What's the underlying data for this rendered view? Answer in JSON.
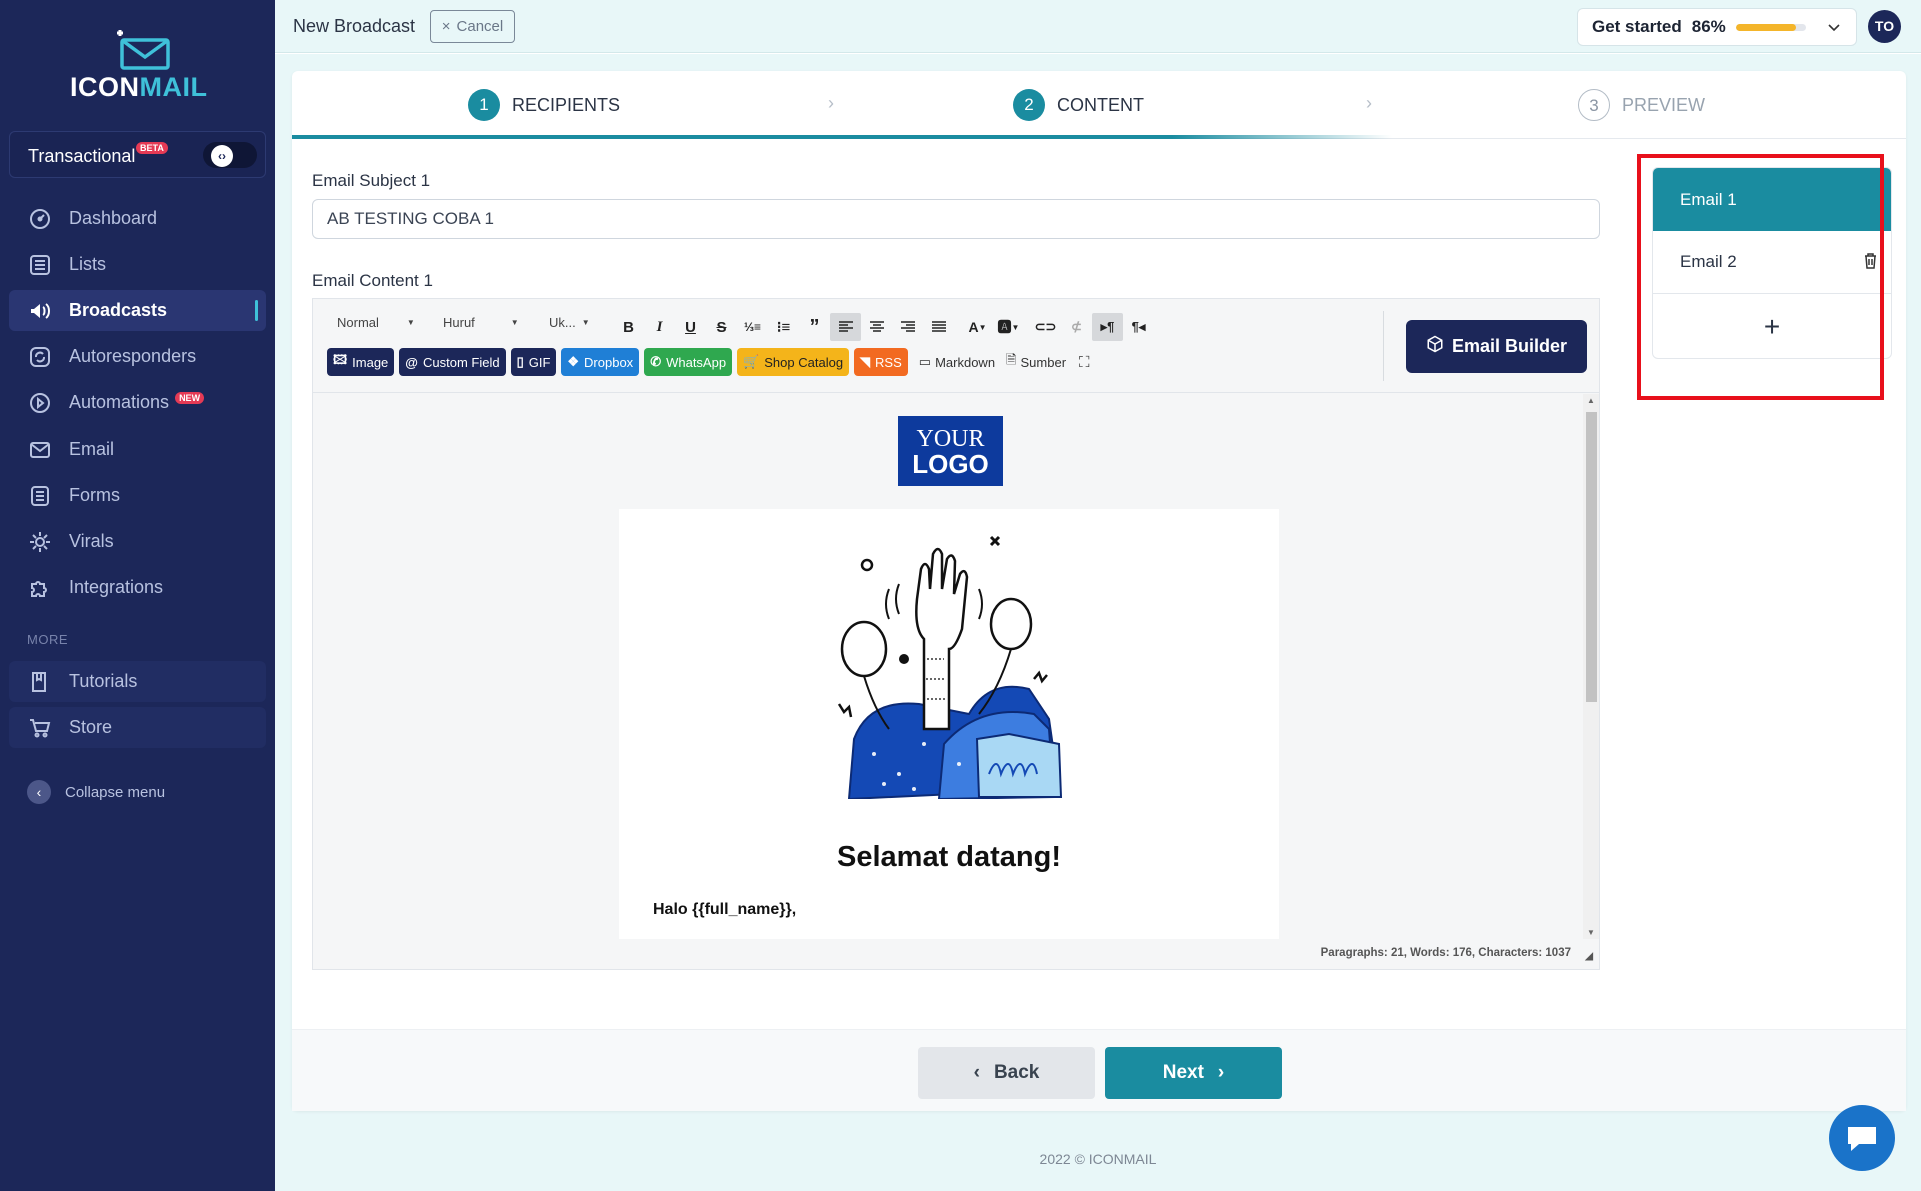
{
  "sidebar": {
    "logo": {
      "part1": "ICON",
      "part2": "MAIL"
    },
    "transactional": {
      "label": "Transactional",
      "badge": "BETA"
    },
    "items": [
      {
        "label": "Dashboard",
        "icon": "dashboard-icon"
      },
      {
        "label": "Lists",
        "icon": "list-icon"
      },
      {
        "label": "Broadcasts",
        "icon": "megaphone-icon",
        "active": true
      },
      {
        "label": "Autoresponders",
        "icon": "autoresponder-icon"
      },
      {
        "label": "Automations",
        "icon": "automation-icon",
        "badge": "NEW"
      },
      {
        "label": "Email",
        "icon": "envelope-icon"
      },
      {
        "label": "Forms",
        "icon": "form-icon"
      },
      {
        "label": "Virals",
        "icon": "viral-icon"
      },
      {
        "label": "Integrations",
        "icon": "puzzle-icon"
      }
    ],
    "more_label": "MORE",
    "more_items": [
      {
        "label": "Tutorials",
        "icon": "book-icon"
      },
      {
        "label": "Store",
        "icon": "cart-icon"
      }
    ],
    "collapse_label": "Collapse menu"
  },
  "topbar": {
    "title": "New Broadcast",
    "cancel_label": "Cancel",
    "get_started": {
      "label": "Get started",
      "percent_label": "86%",
      "progress": 0.86
    },
    "avatar": "TO"
  },
  "steps": [
    {
      "num": "1",
      "label": "RECIPIENTS"
    },
    {
      "num": "2",
      "label": "CONTENT"
    },
    {
      "num": "3",
      "label": "PREVIEW"
    }
  ],
  "form": {
    "subject_label": "Email Subject 1",
    "subject_value": "AB TESTING COBA 1",
    "content_label": "Email Content 1"
  },
  "editor": {
    "format_select": "Normal",
    "font_select": "Huruf",
    "size_select": "Uk...",
    "insert_buttons": [
      {
        "label": "Image",
        "color": "#1c2759",
        "icon": "image-icon"
      },
      {
        "label": "Custom Field",
        "color": "#1c2759",
        "icon": "at-icon"
      },
      {
        "label": "GIF",
        "color": "#1c2759",
        "icon": "gif-icon"
      },
      {
        "label": "Dropbox",
        "color": "#1f7fd6",
        "icon": "dropbox-icon"
      },
      {
        "label": "WhatsApp",
        "color": "#2fa84f",
        "icon": "whatsapp-icon"
      },
      {
        "label": "Shop Catalog",
        "color": "#f4b41a",
        "icon": "shop-cart-icon"
      },
      {
        "label": "RSS",
        "color": "#f26a21",
        "icon": "rss-icon"
      }
    ],
    "markdown_label": "Markdown",
    "source_label": "Sumber",
    "email_builder_label": "Email Builder",
    "logo_line1": "YOUR",
    "logo_line2": "LOGO",
    "welcome_heading": "Selamat datang!",
    "greeting": "Halo {{full_name}},",
    "status": "Paragraphs: 21, Words: 176, Characters: 1037"
  },
  "email_tabs": [
    {
      "label": "Email 1",
      "active": true
    },
    {
      "label": "Email 2",
      "active": false
    }
  ],
  "nav_buttons": {
    "back": "Back",
    "next": "Next"
  },
  "footer": {
    "copyright": "2022 © ICONMAIL"
  }
}
